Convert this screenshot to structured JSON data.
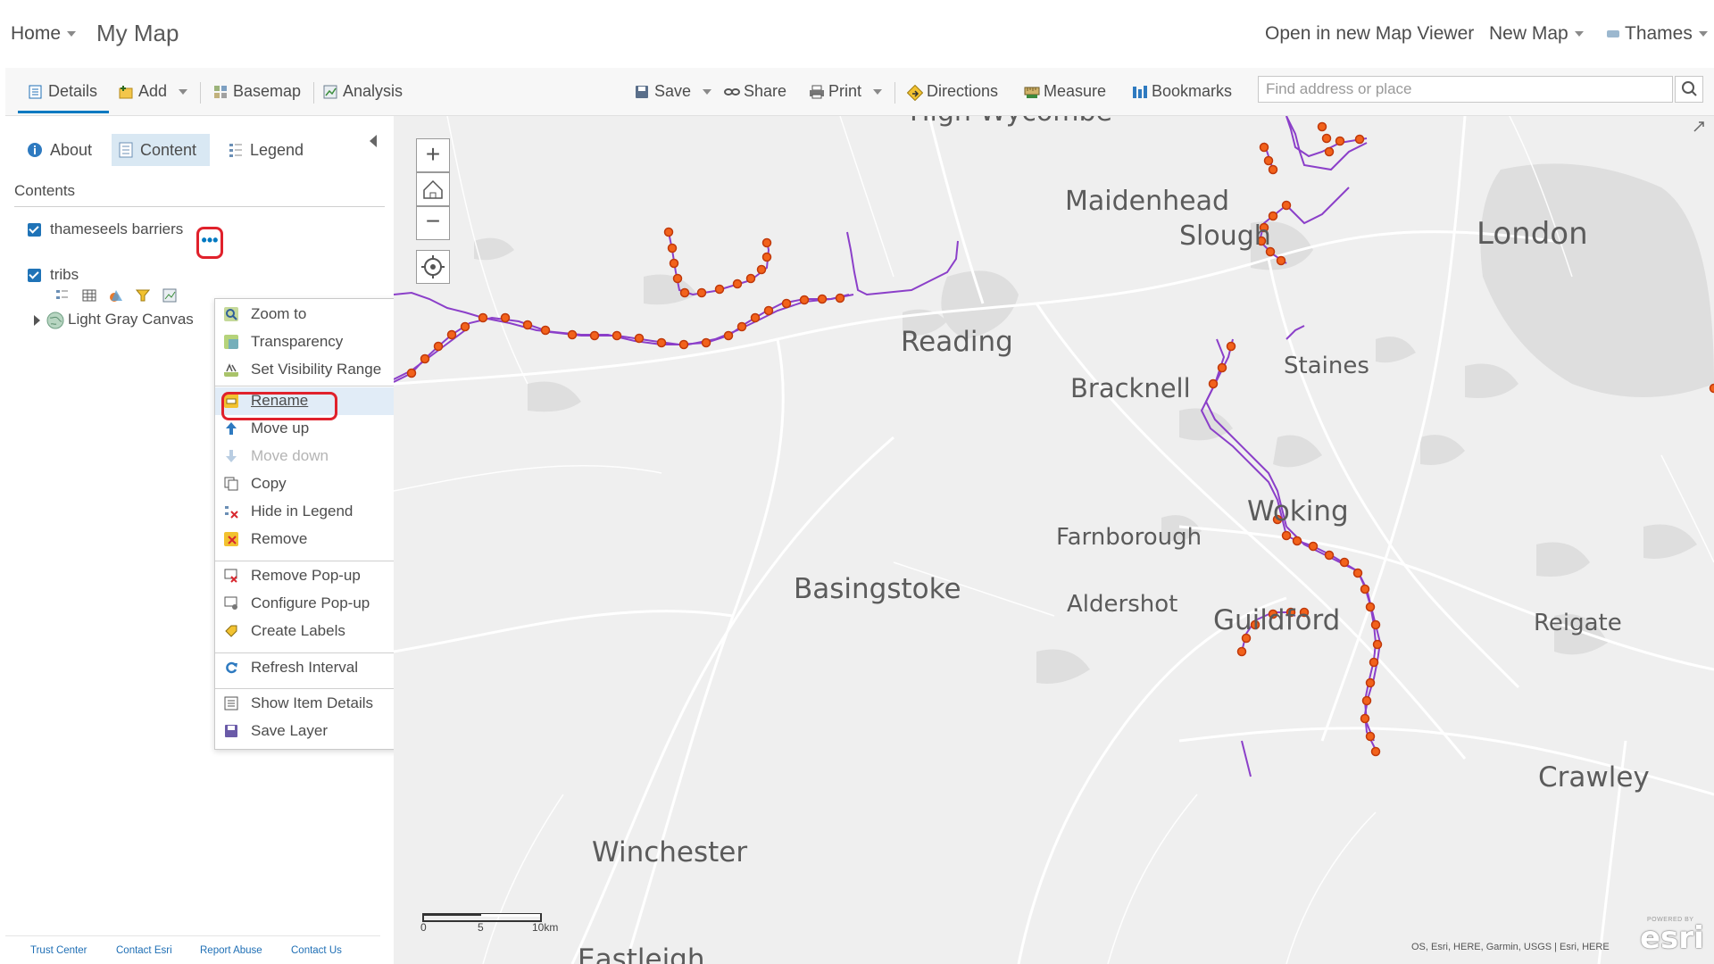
{
  "header": {
    "home_label": "Home",
    "map_title": "My Map",
    "open_new_viewer": "Open in new Map Viewer",
    "new_map": "New Map",
    "user_name": "Thames"
  },
  "toolbar": {
    "details": "Details",
    "add": "Add",
    "basemap": "Basemap",
    "analysis": "Analysis",
    "save": "Save",
    "share": "Share",
    "print": "Print",
    "directions": "Directions",
    "measure": "Measure",
    "bookmarks": "Bookmarks",
    "search_placeholder": "Find address or place"
  },
  "panel": {
    "tabs": {
      "about": "About",
      "content": "Content",
      "legend": "Legend"
    },
    "contents_heading": "Contents",
    "layers": [
      {
        "name": "thameseels barriers",
        "checked": true
      },
      {
        "name": "tribs",
        "checked": true
      },
      {
        "name": "Light Gray Canvas"
      }
    ],
    "more_glyph": "•••"
  },
  "context_menu": {
    "zoom_to": "Zoom to",
    "transparency": "Transparency",
    "set_visibility_range": "Set Visibility Range",
    "rename": "Rename",
    "move_up": "Move up",
    "move_down": "Move down",
    "copy": "Copy",
    "hide_in_legend": "Hide in Legend",
    "remove": "Remove",
    "remove_popup": "Remove Pop-up",
    "configure_popup": "Configure Pop-up",
    "create_labels": "Create Labels",
    "refresh_interval": "Refresh Interval",
    "show_item_details": "Show Item Details",
    "save_layer": "Save Layer"
  },
  "footer": {
    "trust_center": "Trust Center",
    "contact_esri": "Contact Esri",
    "report_abuse": "Report Abuse",
    "contact_us": "Contact Us"
  },
  "map": {
    "places": {
      "high_wycombe": "High Wycombe",
      "maidenhead": "Maidenhead",
      "slough": "Slough",
      "london": "London",
      "reading": "Reading",
      "staines": "Staines",
      "bracknell": "Bracknell",
      "woking": "Woking",
      "farnborough": "Farnborough",
      "basingstoke": "Basingstoke",
      "aldershot": "Aldershot",
      "guildford": "Guildford",
      "reigate": "Reigate",
      "crawley": "Crawley",
      "winchester": "Winchester",
      "eastleigh": "Eastleigh"
    },
    "scale_labels": {
      "zero": "0",
      "five": "5",
      "ten": "10km"
    },
    "attribution": "OS, Esri, HERE, Garmin, USGS | Esri, HERE",
    "esri_logo_text": "esri",
    "esri_powered": "POWERED BY",
    "colors": {
      "river": "#8b3fc9",
      "barrier": "#f2621b",
      "barrier_stroke": "#c0390b",
      "road": "#ffffff",
      "urban": "#dedede"
    }
  }
}
